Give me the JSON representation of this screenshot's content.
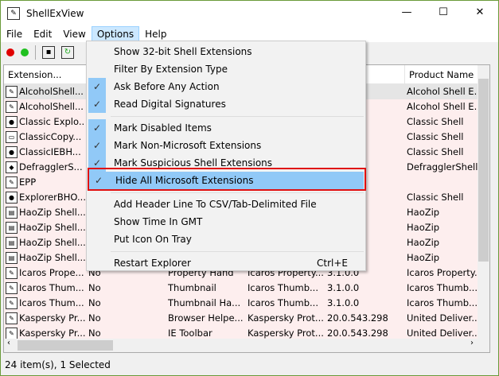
{
  "window": {
    "title": "ShellExView",
    "min": "—",
    "max": "☐",
    "close": "✕"
  },
  "menubar": [
    "File",
    "Edit",
    "View",
    "Options",
    "Help"
  ],
  "columns": [
    "Extension...",
    "",
    "",
    "",
    "",
    "Product Name"
  ],
  "rows": [
    {
      "name": "AlcoholShell...",
      "c1": "",
      "c2": "",
      "c3": "",
      "c4": "",
      "product": "Alcohol Shell E...",
      "sel": true
    },
    {
      "name": "AlcoholShell...",
      "c1": "",
      "c2": "",
      "c3": "",
      "c4": "",
      "product": "Alcohol Shell E..."
    },
    {
      "name": "Classic Explo...",
      "c1": "",
      "c2": "",
      "c3": "",
      "c4": "",
      "product": "Classic Shell"
    },
    {
      "name": "ClassicCopy...",
      "c1": "",
      "c2": "",
      "c3": "",
      "c4": "",
      "product": "Classic Shell"
    },
    {
      "name": "ClassicIEBH...",
      "c1": "",
      "c2": "",
      "c3": "",
      "c4": "",
      "product": "Classic Shell"
    },
    {
      "name": "DefragglerS...",
      "c1": "",
      "c2": "",
      "c3": "",
      "c4": "",
      "product": "DefragglerShell"
    },
    {
      "name": "EPP",
      "c1": "",
      "c2": "",
      "c3": "",
      "c4": "",
      "product": ""
    },
    {
      "name": "ExplorerBHO...",
      "c1": "",
      "c2": "",
      "c3": "",
      "c4": "",
      "product": "Classic Shell"
    },
    {
      "name": "HaoZip Shell...",
      "c1": "",
      "c2": "",
      "c3": "",
      "c4": "",
      "product": "HaoZip"
    },
    {
      "name": "HaoZip Shell...",
      "c1": "",
      "c2": "",
      "c3": "",
      "c4": "",
      "product": "HaoZip"
    },
    {
      "name": "HaoZip Shell...",
      "c1": "",
      "c2": "",
      "c3": "",
      "c4": "",
      "product": "HaoZip"
    },
    {
      "name": "HaoZip Shell...",
      "c1": "",
      "c2": "",
      "c3": "",
      "c4": "",
      "product": "HaoZip"
    },
    {
      "name": "Icaros Prope...",
      "c1": "No",
      "c2": "Property Hand",
      "c3": "Icaros Property...",
      "c4": "3.1.0.0",
      "product": "Icaros Property..."
    },
    {
      "name": "Icaros Thum...",
      "c1": "No",
      "c2": "Thumbnail",
      "c3": "Icaros Thumb...",
      "c4": "3.1.0.0",
      "product": "Icaros Thumb..."
    },
    {
      "name": "Icaros Thum...",
      "c1": "No",
      "c2": "Thumbnail Ha...",
      "c3": "Icaros Thumb...",
      "c4": "3.1.0.0",
      "product": "Icaros Thumb..."
    },
    {
      "name": "Kaspersky Pr...",
      "c1": "No",
      "c2": "Browser Helpe...",
      "c3": "Kaspersky Prot...",
      "c4": "20.0.543.298",
      "product": "United Deliver..."
    },
    {
      "name": "Kaspersky Pr...",
      "c1": "No",
      "c2": "IE Toolbar",
      "c3": "Kaspersky Prot...",
      "c4": "20.0.543.298",
      "product": "United Deliver..."
    }
  ],
  "status": "24 item(s), 1 Selected",
  "options_menu": [
    {
      "label": "Show 32-bit Shell Extensions",
      "checked": false
    },
    {
      "label": "Filter By Extension Type",
      "checked": false
    },
    {
      "label": "Ask Before Any Action",
      "checked": true
    },
    {
      "label": "Read Digital Signatures",
      "checked": true
    },
    {
      "sep": true
    },
    {
      "label": "Mark Disabled Items",
      "checked": true
    },
    {
      "label": "Mark Non-Microsoft Extensions",
      "checked": true
    },
    {
      "label": "Mark Suspicious Shell Extensions",
      "checked": true
    },
    {
      "label": "Hide All Microsoft Extensions",
      "checked": true,
      "highlighted": true
    },
    {
      "sep": true
    },
    {
      "label": "Add Header Line To CSV/Tab-Delimited File",
      "checked": false
    },
    {
      "label": "Show Time In GMT",
      "checked": false
    },
    {
      "label": "Put Icon On Tray",
      "checked": false
    },
    {
      "sep": true
    },
    {
      "label": "Restart Explorer",
      "checked": false,
      "shortcut": "Ctrl+E"
    }
  ],
  "colors": {
    "row_marked": "#fdeeee",
    "menu_highlight": "#91c9f7",
    "red_box": "#e01010"
  }
}
